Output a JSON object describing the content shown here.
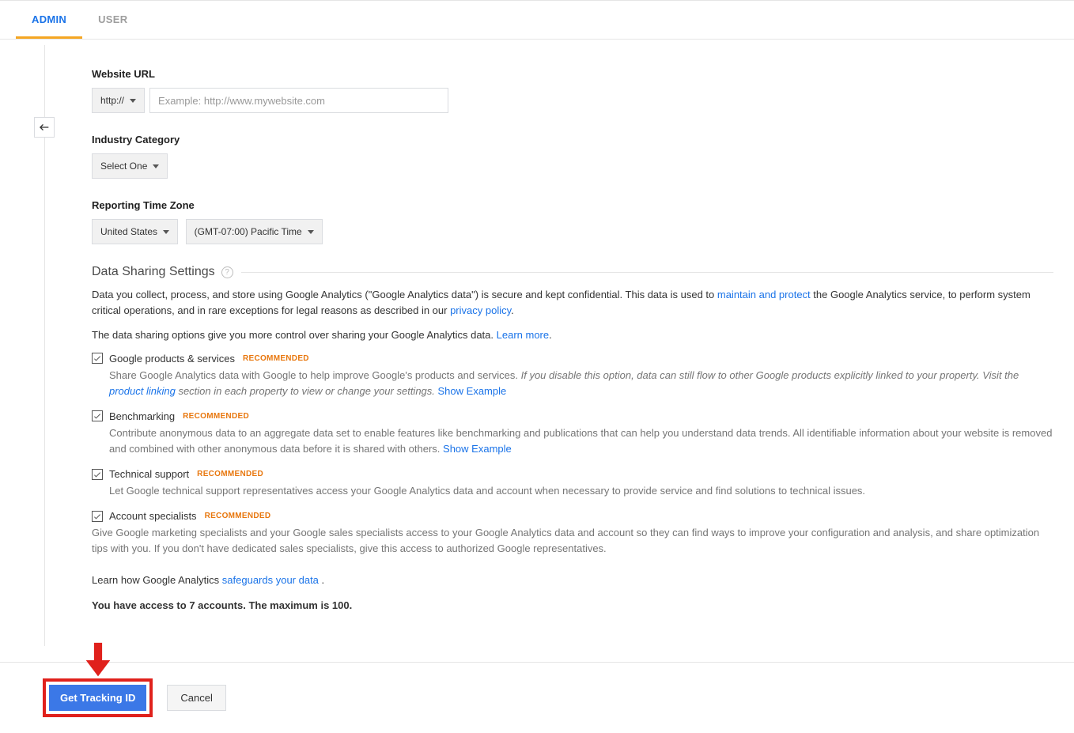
{
  "tabs": {
    "admin": "ADMIN",
    "user": "USER"
  },
  "websiteUrl": {
    "label": "Website URL",
    "protocol": "http://",
    "placeholder": "Example: http://www.mywebsite.com"
  },
  "industry": {
    "label": "Industry Category",
    "value": "Select One"
  },
  "timezone": {
    "label": "Reporting Time Zone",
    "country": "United States",
    "tz": "(GMT-07:00) Pacific Time"
  },
  "dataSharing": {
    "title": "Data Sharing Settings",
    "intro1a": "Data you collect, process, and store using Google Analytics (\"Google Analytics data\") is secure and kept confidential. This data is used to ",
    "linkMaintain": "maintain and protect",
    "intro1b": " the Google Analytics service, to perform system critical operations, and in rare exceptions for legal reasons as described in our ",
    "linkPrivacy": "privacy policy",
    "intro2": "The data sharing options give you more control over sharing your Google Analytics data. ",
    "linkLearnMore": "Learn more",
    "recommendedTag": "RECOMMENDED",
    "items": [
      {
        "label": "Google products & services",
        "desc1": "Share Google Analytics data with Google to help improve Google's products and services. ",
        "italic": "If you disable this option, data can still flow to other Google products explicitly linked to your property. Visit the ",
        "linkItalic": "product linking",
        "italic2": " section in each property to view or change your settings. ",
        "linkShow": "Show Example"
      },
      {
        "label": "Benchmarking",
        "desc1": "Contribute anonymous data to an aggregate data set to enable features like benchmarking and publications that can help you understand data trends. All identifiable information about your website is removed and combined with other anonymous data before it is shared with others. ",
        "linkShow": "Show Example"
      },
      {
        "label": "Technical support",
        "desc1": "Let Google technical support representatives access your Google Analytics data and account when necessary to provide service and find solutions to technical issues."
      },
      {
        "label": "Account specialists",
        "desc1": "Give Google marketing specialists and your Google sales specialists access to your Google Analytics data and account so they can find ways to improve your configuration and analysis, and share optimization tips with you. If you don't have dedicated sales specialists, give this access to authorized Google representatives."
      }
    ],
    "safeguardPre": "Learn how Google Analytics ",
    "safeguardLink": "safeguards your data",
    "safeguardPost": " ."
  },
  "accountLimit": "You have access to 7 accounts. The maximum is 100.",
  "buttons": {
    "primary": "Get Tracking ID",
    "cancel": "Cancel"
  }
}
